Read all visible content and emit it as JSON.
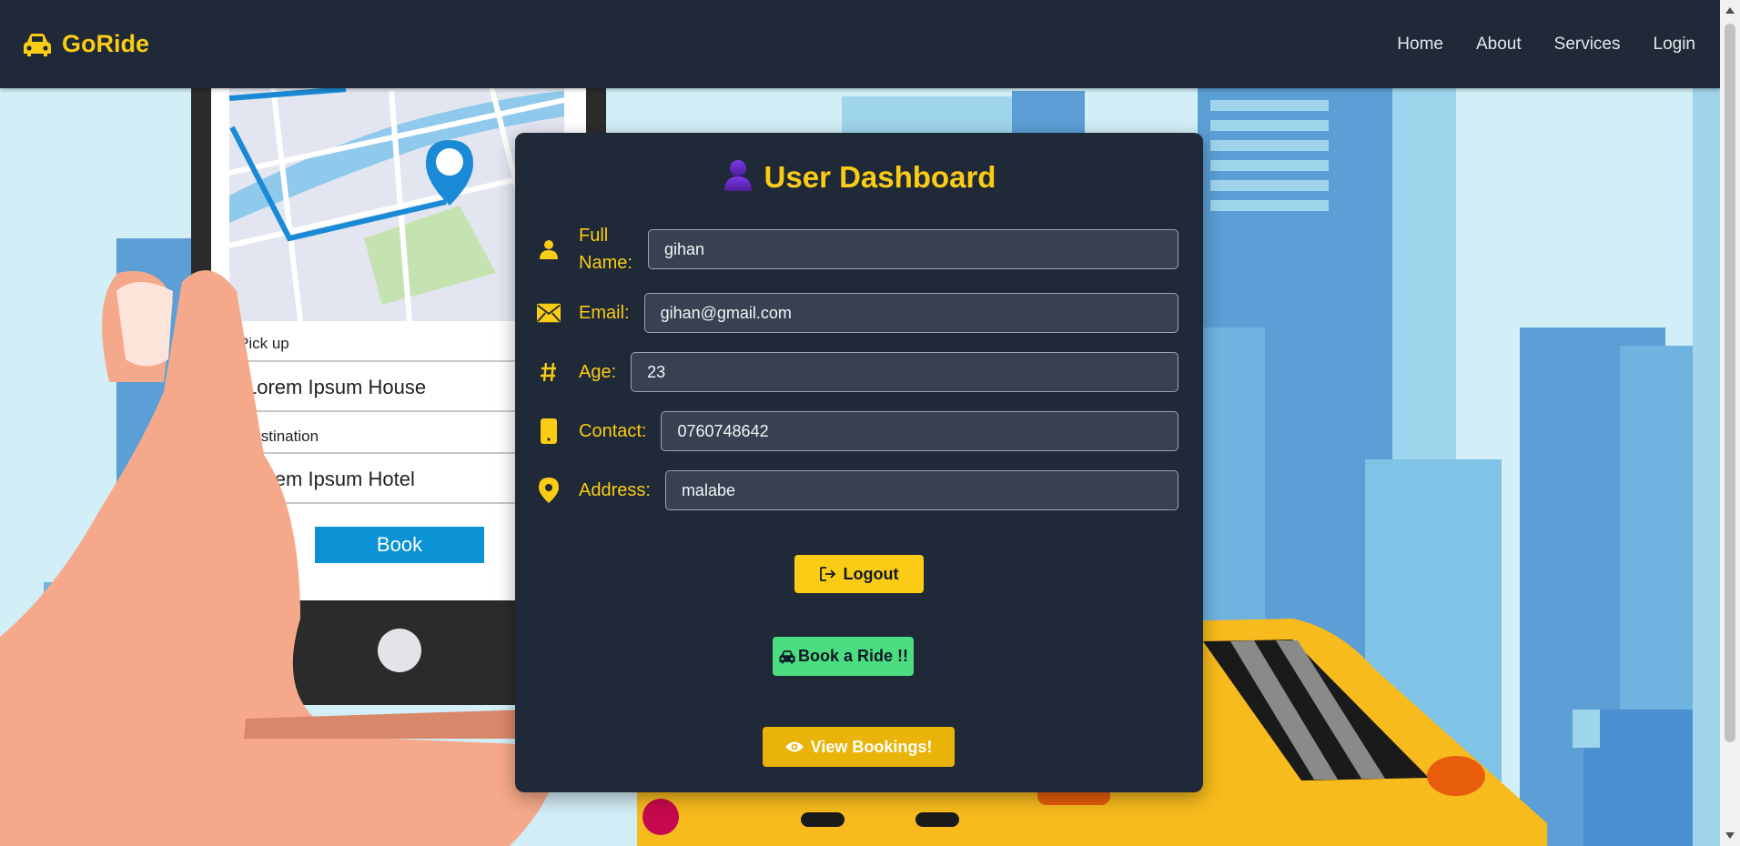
{
  "app": {
    "name": "GoRide",
    "logo_icon": "car-icon",
    "brand_color": "#facc15"
  },
  "nav": {
    "links": [
      "Home",
      "About",
      "Services",
      "Login"
    ]
  },
  "illustration": {
    "pickup_label": "Pick up",
    "pickup_value": "Lorem Ipsum House",
    "destination_label": "Destination",
    "destination_value": "Lorem Ipsum Hotel",
    "book_label": "Book"
  },
  "dashboard": {
    "title": "User Dashboard",
    "title_icon": "user-icon",
    "fields": [
      {
        "label": "Full Name:",
        "value": "gihan",
        "icon": "user-icon"
      },
      {
        "label": "Email:",
        "value": "gihan@gmail.com",
        "icon": "envelope-icon"
      },
      {
        "label": "Age:",
        "value": "23",
        "icon": "hash-icon"
      },
      {
        "label": "Contact:",
        "value": "0760748642",
        "icon": "phone-icon"
      },
      {
        "label": "Address:",
        "value": "malabe",
        "icon": "map-pin-icon"
      }
    ],
    "buttons": {
      "logout": "Logout",
      "book_ride": "Book a Ride !!",
      "view_bookings": "View Bookings!"
    }
  },
  "colors": {
    "navbar_bg": "#1f2937",
    "accent": "#facc15",
    "card_bg": "#1f2937",
    "success": "#4ade80"
  }
}
